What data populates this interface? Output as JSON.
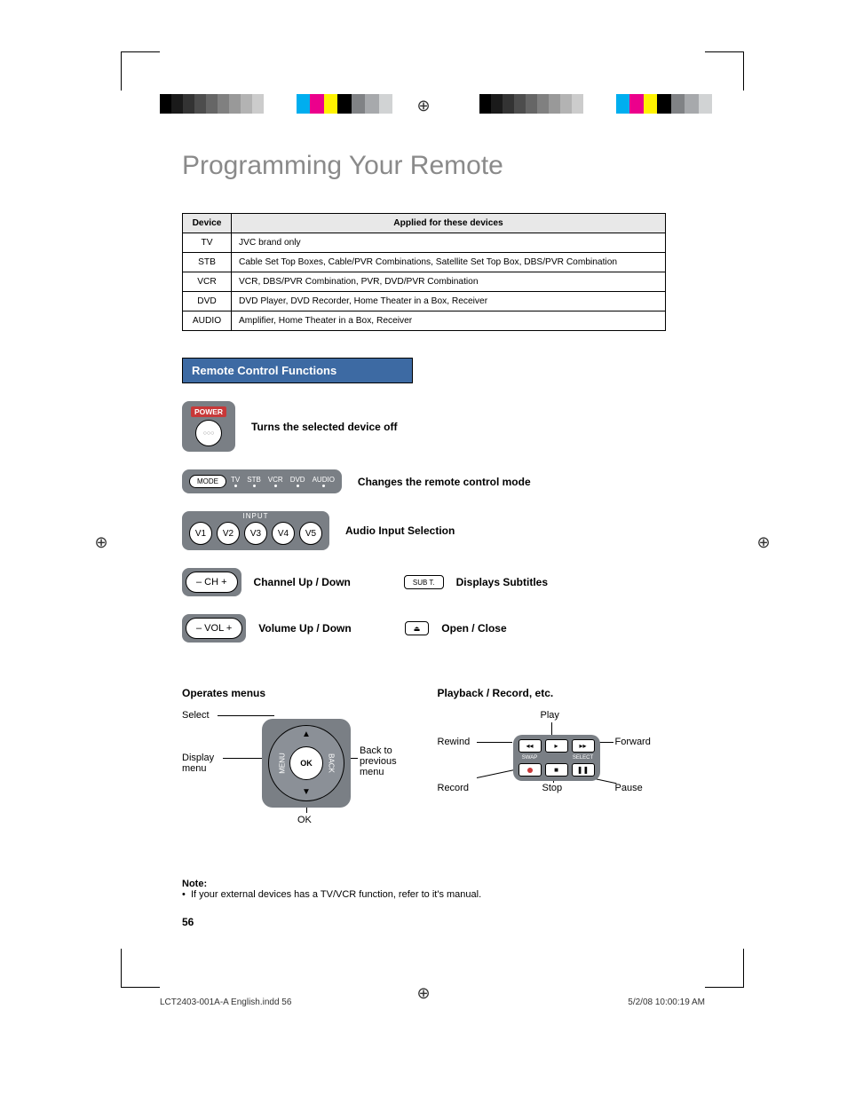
{
  "title": "Programming Your Remote",
  "device_table": {
    "headers": [
      "Device",
      "Applied for these devices"
    ],
    "rows": [
      {
        "device": "TV",
        "desc": "JVC brand only"
      },
      {
        "device": "STB",
        "desc": "Cable Set Top Boxes, Cable/PVR Combinations, Satellite Set Top Box, DBS/PVR Combination"
      },
      {
        "device": "VCR",
        "desc": "VCR, DBS/PVR Combination, PVR, DVD/PVR Combination"
      },
      {
        "device": "DVD",
        "desc": "DVD Player, DVD Recorder, Home Theater in a Box, Receiver"
      },
      {
        "device": "AUDIO",
        "desc": "Amplifier, Home Theater in a Box, Receiver"
      }
    ]
  },
  "section_header": "Remote Control Functions",
  "power": {
    "label": "POWER",
    "desc": "Turns the selected device off"
  },
  "mode": {
    "btn_label": "MODE",
    "items": [
      "TV",
      "STB",
      "VCR",
      "DVD",
      "AUDIO"
    ],
    "desc": "Changes the remote control mode"
  },
  "input": {
    "label": "INPUT",
    "buttons": [
      "V1",
      "V2",
      "V3",
      "V4",
      "V5"
    ],
    "desc": "Audio Input Selection"
  },
  "ch": {
    "label": "– CH +",
    "desc": "Channel Up / Down"
  },
  "sub": {
    "label": "SUB T.",
    "desc": "Displays Subtitles"
  },
  "vol": {
    "label": "– VOL +",
    "desc": "Volume Up / Down"
  },
  "eject": {
    "desc": "Open / Close"
  },
  "menus": {
    "title": "Operates menus",
    "select": "Select",
    "display_menu": "Display menu",
    "back": "Back to previous menu",
    "ok_label": "OK",
    "ok_caption": "OK",
    "menu_side": "MENU",
    "back_side": "BACK"
  },
  "playback": {
    "title": "Playback / Record, etc.",
    "play": "Play",
    "rewind": "Rewind",
    "forward": "Forward",
    "record": "Record",
    "stop": "Stop",
    "pause": "Pause",
    "swap": "SWAP",
    "select": "SELECT"
  },
  "note": {
    "label": "Note:",
    "text": "If your external devices has a TV/VCR function, refer to it's manual."
  },
  "page_number": "56",
  "footer": {
    "file": "LCT2403-001A-A English.indd   56",
    "date": "5/2/08   10:00:19 AM"
  },
  "colorbars": {
    "dark": [
      "#000000",
      "#1a1a1a",
      "#333333",
      "#4d4d4d",
      "#666666",
      "#808080",
      "#999999",
      "#b3b3b3",
      "#cccccc",
      "#ffffff"
    ],
    "cmyk": [
      "#ffffff",
      "#00aeef",
      "#ec008c",
      "#fff200",
      "#000000",
      "#808285",
      "#a7a9ac",
      "#d1d3d4"
    ]
  }
}
